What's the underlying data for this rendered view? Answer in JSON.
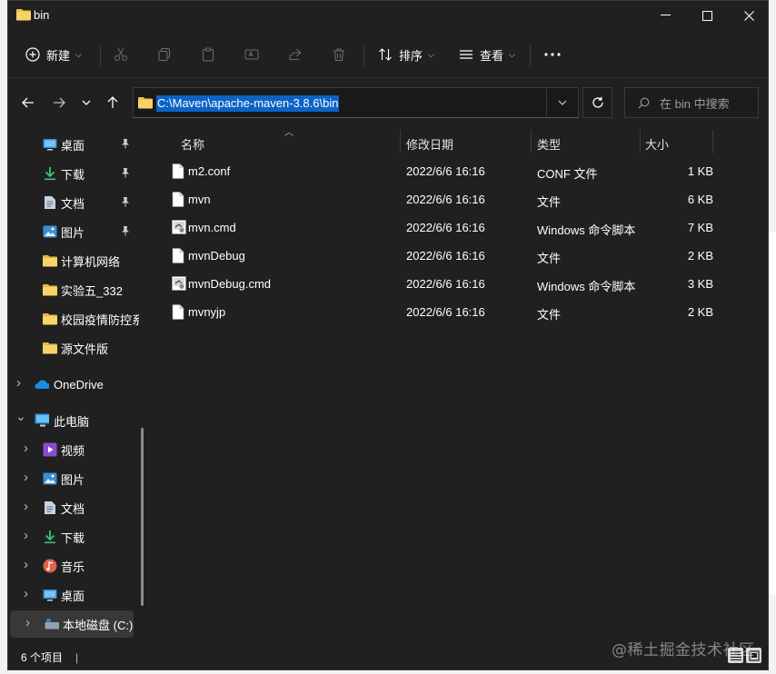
{
  "window": {
    "title": "bin",
    "controls": {
      "minimize": "—",
      "maximize": "☐",
      "close": "✕"
    }
  },
  "toolbar": {
    "new_label": "新建",
    "sort_label": "排序",
    "view_label": "查看",
    "more": "···"
  },
  "address": {
    "path": "C:\\Maven\\apache-maven-3.8.6\\bin"
  },
  "search": {
    "placeholder": "在 bin 中搜索"
  },
  "sidebar": {
    "quick_access": [
      {
        "label": "桌面",
        "icon": "desktop-icon",
        "pinned": true
      },
      {
        "label": "下载",
        "icon": "download-icon",
        "pinned": true
      },
      {
        "label": "文档",
        "icon": "document-icon",
        "pinned": true
      },
      {
        "label": "图片",
        "icon": "picture-icon",
        "pinned": true
      },
      {
        "label": "计算机网络",
        "icon": "folder-icon",
        "pinned": false
      },
      {
        "label": "实验五_332",
        "icon": "folder-icon",
        "pinned": false
      },
      {
        "label": "校园疫情防控系",
        "icon": "folder-icon",
        "pinned": false
      },
      {
        "label": "源文件版",
        "icon": "folder-icon",
        "pinned": false
      }
    ],
    "onedrive": "OneDrive",
    "this_pc": "此电脑",
    "pc_items": [
      {
        "label": "视频",
        "icon": "video-icon"
      },
      {
        "label": "图片",
        "icon": "picture-icon"
      },
      {
        "label": "文档",
        "icon": "document-icon"
      },
      {
        "label": "下载",
        "icon": "download-icon"
      },
      {
        "label": "音乐",
        "icon": "music-icon"
      },
      {
        "label": "桌面",
        "icon": "desktop-icon"
      },
      {
        "label": "本地磁盘 (C:)",
        "icon": "drive-icon"
      }
    ]
  },
  "columns": {
    "name": "名称",
    "date": "修改日期",
    "type": "类型",
    "size": "大小"
  },
  "files": [
    {
      "name": "m2.conf",
      "date": "2022/6/6 16:16",
      "type": "CONF 文件",
      "size": "1 KB",
      "icon": "file-icon"
    },
    {
      "name": "mvn",
      "date": "2022/6/6 16:16",
      "type": "文件",
      "size": "6 KB",
      "icon": "file-icon"
    },
    {
      "name": "mvn.cmd",
      "date": "2022/6/6 16:16",
      "type": "Windows 命令脚本",
      "size": "7 KB",
      "icon": "cmd-file-icon"
    },
    {
      "name": "mvnDebug",
      "date": "2022/6/6 16:16",
      "type": "文件",
      "size": "2 KB",
      "icon": "file-icon"
    },
    {
      "name": "mvnDebug.cmd",
      "date": "2022/6/6 16:16",
      "type": "Windows 命令脚本",
      "size": "3 KB",
      "icon": "cmd-file-icon"
    },
    {
      "name": "mvnyjp",
      "date": "2022/6/6 16:16",
      "type": "文件",
      "size": "2 KB",
      "icon": "file-icon"
    }
  ],
  "status": {
    "count": "6 个项目",
    "separator": "|"
  },
  "watermark": "@稀土掘金技术社区",
  "colors": {
    "window_bg": "#202020",
    "selection_blue": "#0b63c5",
    "folder_yellow": "#f0c24a"
  }
}
